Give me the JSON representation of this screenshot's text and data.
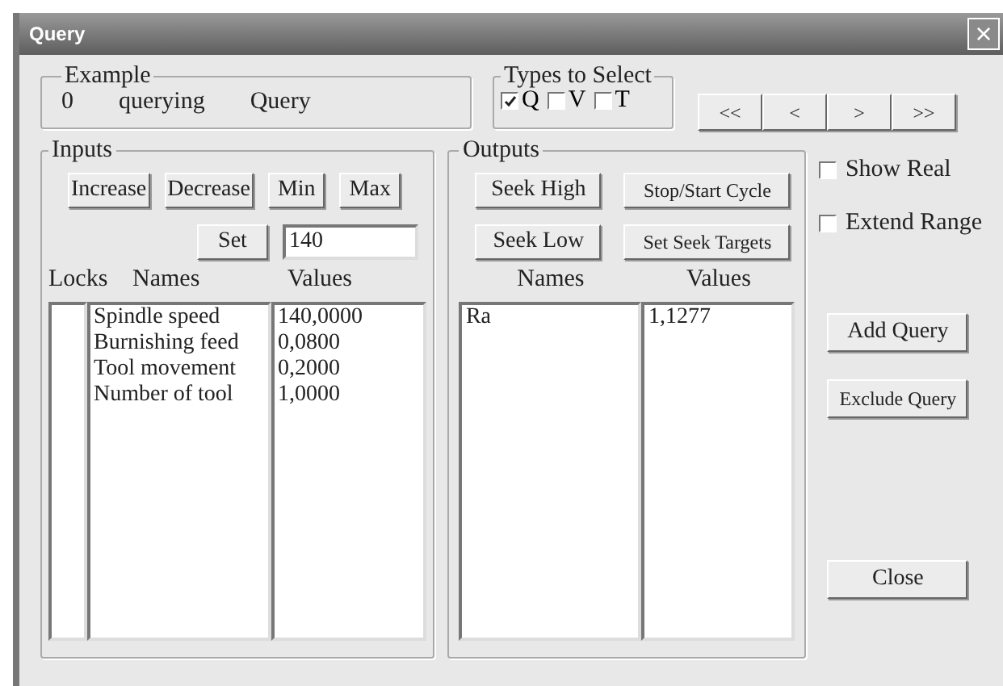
{
  "window": {
    "title": "Query",
    "close": "×"
  },
  "example": {
    "title": "Example",
    "fields": [
      "0",
      "querying",
      "Query"
    ]
  },
  "types": {
    "title": "Types to Select",
    "items": [
      {
        "label": "Q",
        "checked": true
      },
      {
        "label": "V",
        "checked": false
      },
      {
        "label": "T",
        "checked": false
      }
    ]
  },
  "nav_buttons": [
    "<<",
    "<",
    ">",
    ">>"
  ],
  "inputs": {
    "title": "Inputs",
    "buttons": [
      "Increase",
      "Decrease",
      "Min",
      "Max"
    ],
    "set_button": "Set",
    "value": "140",
    "columns": [
      "Locks",
      "Names",
      "Values"
    ],
    "rows": [
      {
        "name": "Spindle speed",
        "value": "140,0000"
      },
      {
        "name": "Burnishing feed",
        "value": "0,0800"
      },
      {
        "name": "Tool movement",
        "value": "0,2000"
      },
      {
        "name": "Number of tool",
        "value": "1,0000"
      }
    ]
  },
  "outputs": {
    "title": "Outputs",
    "buttons": [
      "Seek High",
      "Stop/Start Cycle",
      "Seek Low",
      "Set Seek Targets"
    ],
    "columns": [
      "Names",
      "Values"
    ],
    "rows": [
      {
        "name": "Ra",
        "value": "1,1277"
      }
    ]
  },
  "options": [
    {
      "label": "Show Real",
      "checked": false
    },
    {
      "label": "Extend Range",
      "checked": false
    }
  ],
  "actions": [
    "Add Query",
    "Exclude Query"
  ],
  "close_button": "Close"
}
